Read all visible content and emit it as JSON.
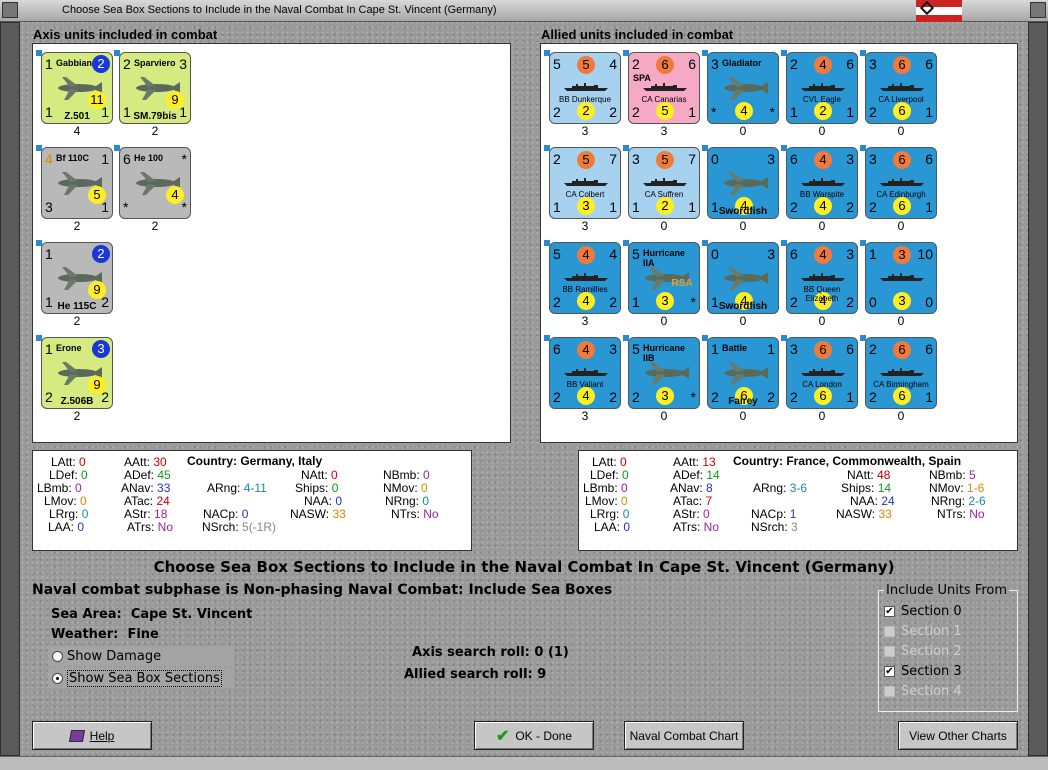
{
  "window": {
    "title": "Choose Sea Box Sections to Include in the Naval Combat In Cape St. Vincent (Germany)"
  },
  "axis": {
    "label": "Axis units included in combat",
    "units": [
      {
        "kind": "air",
        "color": "axis-air",
        "name": "Gabbiano",
        "sub": "Z.501",
        "tl": "1",
        "tr": "2",
        "tr_style": "b",
        "bl": "1",
        "br": "1",
        "mid": "11",
        "mid_style": "y",
        "count": "4"
      },
      {
        "kind": "air",
        "color": "axis-air",
        "name": "Sparviero",
        "sub": "SM.79bis",
        "tl": "2",
        "tr": "3",
        "bl": "1",
        "br": "1",
        "mid": "9",
        "mid_style": "y",
        "count": "2"
      },
      {
        "kind": "air",
        "color": "grey",
        "name": "Bf 110C",
        "sub": "",
        "tl": "4",
        "tr": "1",
        "bl": "3",
        "br": "1",
        "mid": "5",
        "mid_style": "y",
        "count": "2"
      },
      {
        "kind": "air",
        "color": "grey",
        "name": "He 100",
        "sub": "",
        "tl": "6",
        "tr": "*",
        "bl": "*",
        "br": "*",
        "mid": "4",
        "mid_style": "y",
        "count": "2"
      },
      {
        "kind": "air",
        "color": "grey",
        "name": "",
        "sub": "He 115C",
        "tl": "1",
        "tr": "2",
        "tr_style": "b",
        "bl": "1",
        "br": "2",
        "mid": "9",
        "mid_style": "y",
        "count": "2"
      },
      {
        "kind": "air",
        "color": "axis-air",
        "name": "Erone",
        "sub": "Z.506B",
        "tl": "1",
        "tr": "3",
        "tr_style": "b",
        "bl": "2",
        "br": "2",
        "mid": "9",
        "mid_style": "y",
        "count": "2"
      }
    ]
  },
  "allied": {
    "label": "Allied units included in combat",
    "units": [
      {
        "kind": "ship",
        "color": "lblue",
        "name": "BB Dunkerque",
        "tl": "5",
        "tm": "5",
        "tm_style": "o",
        "tr": "4",
        "bl": "2",
        "bm": "2",
        "bm_style": "y",
        "br": "2",
        "count": "3"
      },
      {
        "kind": "ship",
        "color": "pink",
        "name": "CA Canarias",
        "label2": "SPA",
        "tl": "2",
        "tm": "6",
        "tm_style": "o",
        "tr": "6",
        "bl": "2",
        "bm": "5",
        "bm_style": "y",
        "br": "1",
        "count": "3"
      },
      {
        "kind": "air",
        "color": "blue",
        "name": "Gladiator",
        "tl": "3",
        "tr": "",
        "bl": "*",
        "bm": "4",
        "bm_style": "y",
        "br": "*",
        "count": "0"
      },
      {
        "kind": "ship",
        "color": "blue",
        "name": "CVL Eagle",
        "tl": "2",
        "tm": "4",
        "tm_style": "o",
        "tr": "6",
        "bl": "1",
        "bm": "2",
        "bm_style": "y",
        "br": "1",
        "count": "0"
      },
      {
        "kind": "ship",
        "color": "blue",
        "name": "CA Liverpool",
        "tl": "3",
        "tm": "6",
        "tm_style": "o",
        "tr": "6",
        "bl": "2",
        "bm": "6",
        "bm_style": "y",
        "br": "1",
        "count": "0"
      },
      {
        "kind": "ship",
        "color": "lblue",
        "name": "CA Colbert",
        "tl": "2",
        "tm": "5",
        "tm_style": "o",
        "tr": "7",
        "bl": "1",
        "bm": "3",
        "bm_style": "y",
        "br": "1",
        "count": "3"
      },
      {
        "kind": "ship",
        "color": "lblue",
        "name": "CA Suffren",
        "tl": "3",
        "tm": "5",
        "tm_style": "o",
        "tr": "7",
        "bl": "1",
        "bm": "2",
        "bm_style": "y",
        "br": "1",
        "count": "0"
      },
      {
        "kind": "air",
        "color": "blue",
        "name": "",
        "sub": "Swordfish",
        "tl": "0",
        "tr": "3",
        "bl": "1",
        "bm": "4",
        "bm_style": "y",
        "br": "",
        "count": "0"
      },
      {
        "kind": "ship",
        "color": "blue",
        "name": "BB Warspite",
        "tl": "6",
        "tm": "4",
        "tm_style": "o",
        "tr": "3",
        "bl": "2",
        "bm": "4",
        "bm_style": "y",
        "br": "2",
        "count": "0"
      },
      {
        "kind": "ship",
        "color": "blue",
        "name": "CA Edinburgh",
        "tl": "3",
        "tm": "6",
        "tm_style": "o",
        "tr": "6",
        "bl": "2",
        "bm": "6",
        "bm_style": "y",
        "br": "1",
        "count": "0"
      },
      {
        "kind": "ship",
        "color": "blue",
        "name": "BB Ramillies",
        "tl": "5",
        "tm": "4",
        "tm_style": "o",
        "tr": "4",
        "bl": "2",
        "bm": "4",
        "bm_style": "y",
        "br": "2",
        "count": "3"
      },
      {
        "kind": "air",
        "color": "blue",
        "name": "Hurricane IIA",
        "sub": "RSA",
        "tl": "5",
        "tr": "",
        "bl": "1",
        "bm": "3",
        "bm_style": "y",
        "br": "*",
        "count": "0"
      },
      {
        "kind": "air",
        "color": "blue",
        "name": "",
        "sub": "Swordfish",
        "tl": "0",
        "tr": "3",
        "bl": "1",
        "bm": "4",
        "bm_style": "y",
        "br": "",
        "count": "0"
      },
      {
        "kind": "ship",
        "color": "blue",
        "name": "BB Queen Elizabeth",
        "tl": "6",
        "tm": "4",
        "tm_style": "o",
        "tr": "3",
        "bl": "2",
        "bm": "4",
        "bm_style": "y",
        "br": "2",
        "count": "0"
      },
      {
        "kind": "ship",
        "color": "blue",
        "name": "",
        "tl": "1",
        "tm": "3",
        "tm_style": "o",
        "tr": "10",
        "bl": "0",
        "bm": "3",
        "bm_style": "y",
        "br": "0",
        "count": "0"
      },
      {
        "kind": "ship",
        "color": "blue",
        "name": "BB Valiant",
        "tl": "6",
        "tm": "4",
        "tm_style": "o",
        "tr": "3",
        "bl": "2",
        "bm": "4",
        "bm_style": "y",
        "br": "2",
        "count": "3"
      },
      {
        "kind": "air",
        "color": "blue",
        "name": "Hurricane IIB",
        "tl": "5",
        "tr": "",
        "bl": "2",
        "bm": "3",
        "bm_style": "y",
        "br": "*",
        "count": "0"
      },
      {
        "kind": "air",
        "color": "blue",
        "name": "Battle",
        "sub": "Fairey",
        "tl": "1",
        "tr": "1",
        "bl": "2",
        "bm": "6",
        "bm_style": "y",
        "br": "2",
        "count": "0"
      },
      {
        "kind": "ship",
        "color": "blue",
        "name": "CA London",
        "tl": "3",
        "tm": "6",
        "tm_style": "o",
        "tr": "6",
        "bl": "2",
        "bm": "6",
        "bm_style": "y",
        "br": "1",
        "count": "0"
      },
      {
        "kind": "ship",
        "color": "blue",
        "name": "CA Birmingham",
        "tl": "2",
        "tm": "6",
        "tm_style": "o",
        "tr": "6",
        "bl": "2",
        "bm": "6",
        "bm_style": "y",
        "br": "1",
        "count": "0"
      }
    ]
  },
  "axis_stats": {
    "latt": "0",
    "aatt": "30",
    "country_label": "Country:",
    "country": "Germany, Italy",
    "ldef": "0",
    "adef": "45",
    "natt": "0",
    "nbmb": "0",
    "lbmb": "0",
    "anav": "33",
    "arng": "4-11",
    "ships": "0",
    "nmov": "0",
    "lmov": "0",
    "atac": "24",
    "naa": "0",
    "nrng": "0",
    "lrg": "0",
    "astr": "18",
    "nacp": "0",
    "nasw": "33",
    "ntrs": "No",
    "laa": "0",
    "atrs": "No",
    "nsrch": "5(-1R)"
  },
  "allied_stats": {
    "latt": "0",
    "aatt": "13",
    "country_label": "Country:",
    "country": "France, Commonwealth, Spain",
    "ldef": "0",
    "adef": "14",
    "natt": "48",
    "nbmb": "5",
    "lbmb": "0",
    "anav": "8",
    "arng": "3-6",
    "ships": "14",
    "nmov": "1-6",
    "lmov": "0",
    "atac": "7",
    "naa": "24",
    "nrng": "2-6",
    "lrg": "0",
    "astr": "0",
    "nacp": "1",
    "nasw": "33",
    "ntrs": "No",
    "laa": "0",
    "atrs": "No",
    "nsrch": "3"
  },
  "main": {
    "title": "Choose Sea Box Sections to Include in the Naval Combat In Cape St. Vincent (Germany)",
    "subphase": "Naval combat subphase is Non-phasing Naval Combat: Include Sea Boxes",
    "sea_area_label": "Sea Area:",
    "sea_area": "Cape St. Vincent",
    "weather_label": "Weather:",
    "weather": "Fine",
    "show_damage": "Show Damage",
    "show_sections": "Show Sea Box Sections",
    "axis_search": "Axis search roll: 0 (1)",
    "allied_search": "Allied search roll: 9"
  },
  "sections": {
    "title": "Include Units From",
    "items": [
      {
        "label": "Section 0",
        "checked": true,
        "enabled": true
      },
      {
        "label": "Section 1",
        "checked": false,
        "enabled": false
      },
      {
        "label": "Section 2",
        "checked": false,
        "enabled": false
      },
      {
        "label": "Section 3",
        "checked": true,
        "enabled": true
      },
      {
        "label": "Section 4",
        "checked": false,
        "enabled": false
      }
    ]
  },
  "buttons": {
    "help": "Help",
    "ok": "OK - Done",
    "naval_chart": "Naval Combat Chart",
    "other_charts": "View Other Charts"
  },
  "colors": {
    "axis_air": "#d5ea80",
    "grey": "#b9b9b9",
    "light_blue": "#a6d1ef",
    "allied_blue": "#2a97d5",
    "spain_pink": "#f5a9c5",
    "red": "#cc0000",
    "green": "#119911",
    "blue": "#2233cc",
    "teal": "#1a8aa0",
    "purple": "#9922aa",
    "orange": "#dd8800",
    "gray": "#888888"
  }
}
